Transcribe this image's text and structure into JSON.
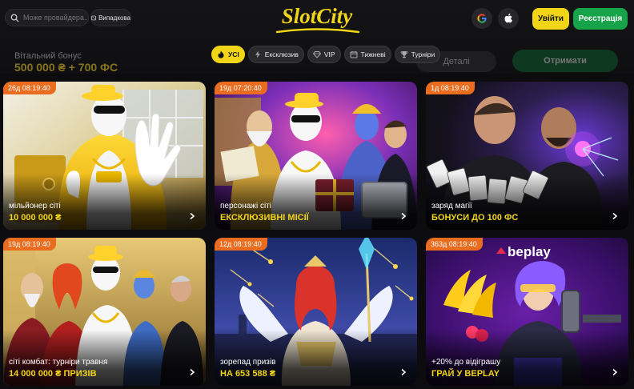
{
  "header": {
    "search_placeholder": "Може провайдера...",
    "random_label": "Випадкова",
    "logo_text": "SlotCity",
    "login_label": "Увійти",
    "register_label": "Реєстрація",
    "social_icons": [
      "google-icon",
      "apple-icon"
    ]
  },
  "bonus_banner": {
    "title": "Вітальний бонус",
    "amount": "500 000 ₴ + 700 ФС",
    "details_label": "Деталі",
    "receive_label": "Отримати"
  },
  "tabs": [
    {
      "label": "УСІ",
      "icon": "fire-icon",
      "active": true
    },
    {
      "label": "Ексклюзив",
      "icon": "lightning-icon",
      "active": false
    },
    {
      "label": "VIP",
      "icon": "diamond-icon",
      "active": false
    },
    {
      "label": "Тижневі",
      "icon": "calendar-icon",
      "active": false
    },
    {
      "label": "Турніри",
      "icon": "trophy-icon",
      "active": false
    }
  ],
  "cards": [
    {
      "timer": "26д 08:19:40",
      "subtitle": "мільйонер сіті",
      "title": "10 000 000 ₴"
    },
    {
      "timer": "19д 07:20:40",
      "subtitle": "персонажі сіті",
      "title": "ЕКСКЛЮЗИВНІ МІСІЇ"
    },
    {
      "timer": "1д 08:19:40",
      "subtitle": "заряд магії",
      "title": "БОНУСИ ДО 100 ФС"
    },
    {
      "timer": "19д 08:19:40",
      "subtitle": "сіті комбат: турніри травня",
      "title": "14 000 000 ₴ ПРИЗІВ"
    },
    {
      "timer": "12д 08:19:40",
      "subtitle": "зорепад призів",
      "title": "НА 653 588 ₴"
    },
    {
      "timer": "363д 08:19:40",
      "subtitle": "+20% до відіграшу",
      "title": "ГРАЙ У BEPLAY",
      "brand": "beplay"
    }
  ],
  "colors": {
    "accent_yellow": "#f2d516",
    "register_green": "#16a34a",
    "timer_orange": "#ea6c1f"
  }
}
